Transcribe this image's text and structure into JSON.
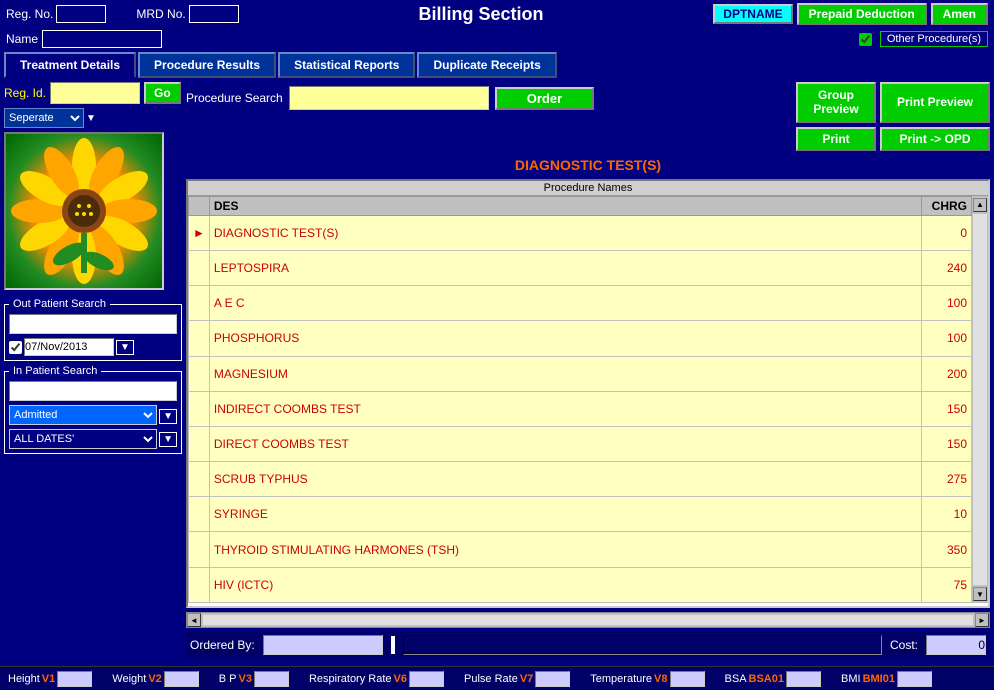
{
  "header": {
    "title": "Billing Section",
    "reg_no_label": "Reg. No.",
    "mrd_no_label": "MRD No.",
    "dptname": "DPTNAME",
    "prepaid_deduction": "Prepaid Deduction",
    "amen": "Amen",
    "other_procedures": "Other Procedure(s)",
    "name_label": "Name"
  },
  "tabs": {
    "items": [
      {
        "label": "Treatment Details",
        "active": true
      },
      {
        "label": "Procedure Results"
      },
      {
        "label": "Statistical Reports"
      },
      {
        "label": "Duplicate Receipts"
      }
    ]
  },
  "left_panel": {
    "reg_id_label": "Reg. Id.",
    "go_button": "Go",
    "separate_label": "Seperate",
    "out_patient_label": "Out Patient Search",
    "date_value": "07/Nov/2013",
    "in_patient_label": "In Patient Search",
    "admitted_label": "Admitted",
    "all_dates_label": "ALL DATES'"
  },
  "right_panel": {
    "proc_search_label": "Procedure Search",
    "order_button": "Order",
    "group_preview_button": "Group Preview",
    "print_preview_button": "Print Preview",
    "print_button": "Print",
    "print_opd_button": "Print -> OPD",
    "diag_title": "DIAGNOSTIC TEST(S)",
    "table": {
      "col_des": "DES",
      "col_chrg": "CHRG",
      "rows": [
        {
          "name": "DIAGNOSTIC TEST(S)",
          "charge": "0",
          "selected": true
        },
        {
          "name": "LEPTOSPIRA",
          "charge": "240"
        },
        {
          "name": "A E C",
          "charge": "100"
        },
        {
          "name": "PHOSPHORUS",
          "charge": "100"
        },
        {
          "name": "MAGNESIUM",
          "charge": "200"
        },
        {
          "name": "INDIRECT COOMBS TEST",
          "charge": "150"
        },
        {
          "name": "DIRECT COOMBS TEST",
          "charge": "150"
        },
        {
          "name": "SCRUB TYPHUS",
          "charge": "275"
        },
        {
          "name": "SYRINGE",
          "charge": "10"
        },
        {
          "name": "THYROID STIMULATING HARMONES (TSH)",
          "charge": "350"
        },
        {
          "name": "HIV (ICTC)",
          "charge": "75"
        }
      ]
    },
    "ordered_by_label": "Ordered By:",
    "cost_label": "Cost:",
    "cost_value": "0"
  },
  "footer": {
    "height_label": "Height",
    "height_val": "V1",
    "weight_label": "Weight",
    "weight_val": "V2",
    "bp_label": "B P",
    "bp_val": "V3",
    "rr_label": "Respiratory Rate",
    "rr_val": "V6",
    "pulse_label": "Pulse Rate",
    "pulse_val": "V7",
    "temp_label": "Temperature",
    "temp_val": "V8",
    "bsa_label": "BSA",
    "bsa_val": "BSA01",
    "bmi_label": "BMI",
    "bmi_val": "BMI01"
  }
}
